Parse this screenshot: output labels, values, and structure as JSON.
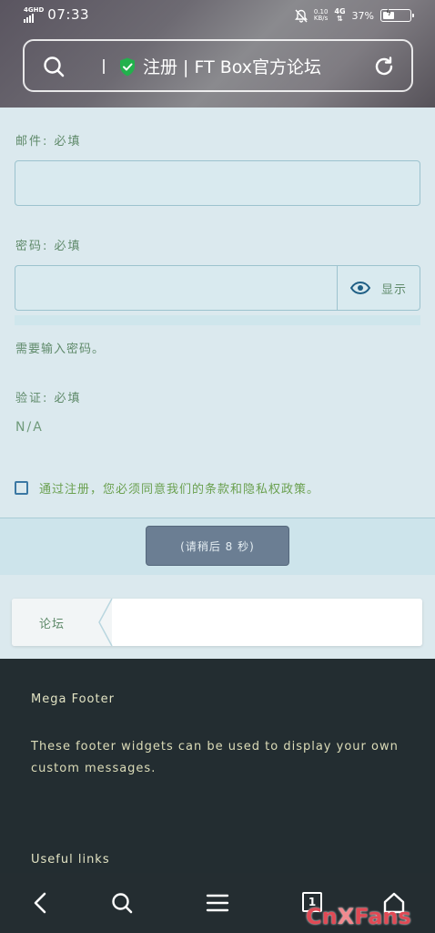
{
  "status_bar": {
    "network_badge": "4GHD",
    "time": "07:33",
    "speed_value": "0.10",
    "speed_unit": "KB/s",
    "network_type": "4G",
    "battery": "37%"
  },
  "address_bar": {
    "title": "注册 | FT Box官方论坛"
  },
  "form": {
    "email_label": "邮件:  必填",
    "password_label": "密码:  必填",
    "show_password_label": "显示",
    "password_helper": "需要输入密码。",
    "captcha_label": "验证:  必填",
    "captcha_value": "N/A",
    "agree_text": "通过注册，您必须同意我们的条款和隐私权政策。",
    "submit_label": "(请稍后 8 秒)"
  },
  "breadcrumb": {
    "items": [
      "论坛"
    ]
  },
  "footer": {
    "title": "Mega Footer",
    "text": "These footer widgets can be used to display your own custom messages.",
    "links_title": "Useful links"
  },
  "bottom_nav": {
    "tabs_count": "1"
  },
  "watermark": {
    "part1": "Cn",
    "part2": "X",
    "part3": "Fans"
  },
  "colors": {
    "accent_green": "#6aa04f",
    "page_background": "#dbe9ee",
    "footer_background": "#232d31",
    "checkbox_blue": "#3b78a3"
  }
}
